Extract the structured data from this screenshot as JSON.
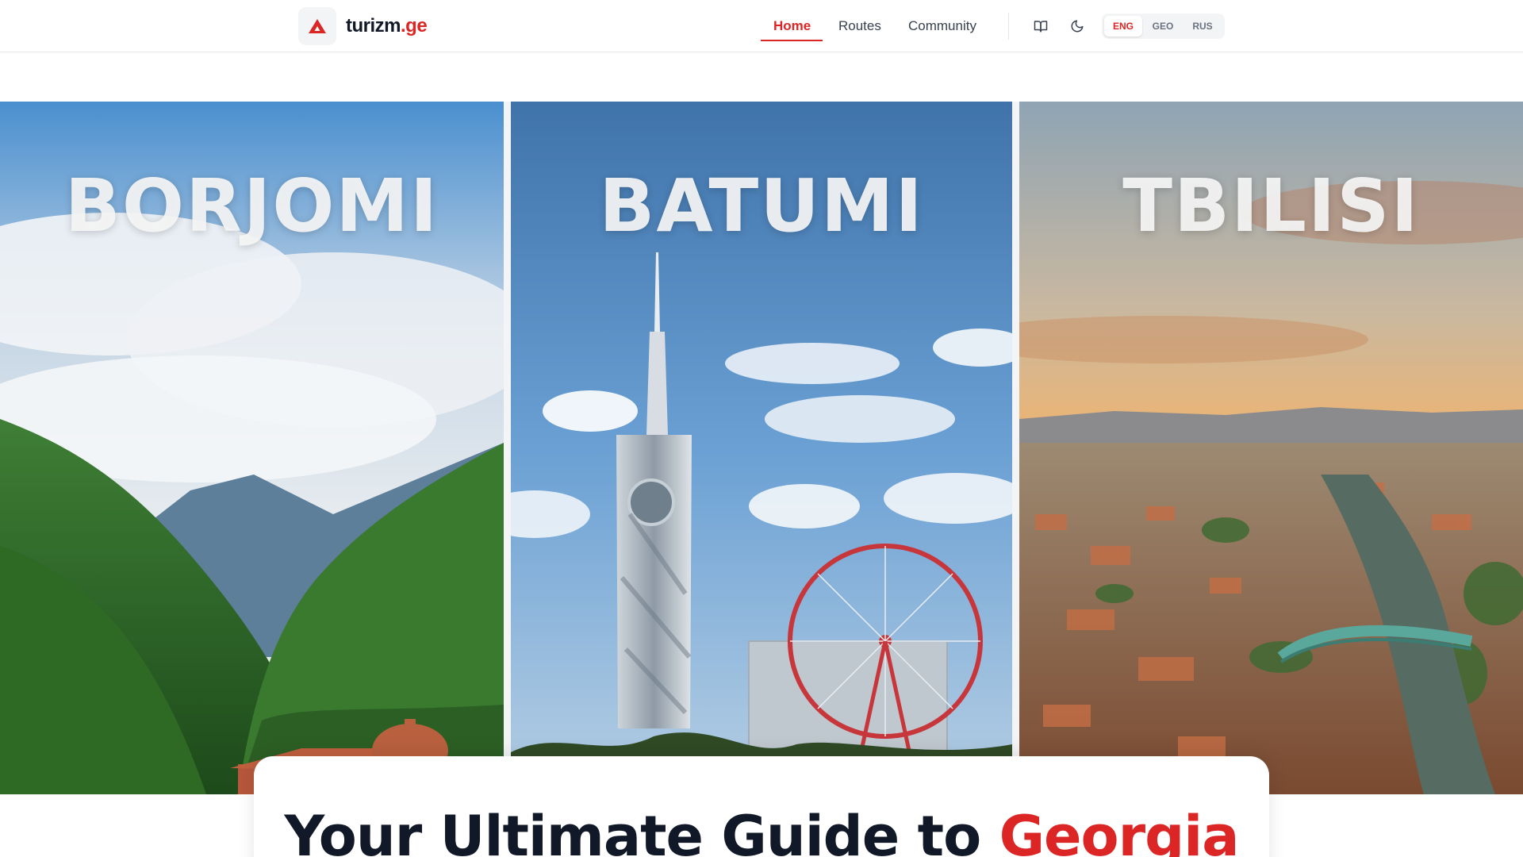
{
  "brand": {
    "name": "turizm",
    "tld": ".ge",
    "icon": "mountain-logo-icon",
    "accent_color": "#dc2626"
  },
  "nav": {
    "links": [
      {
        "label": "Home",
        "active": true
      },
      {
        "label": "Routes",
        "active": false
      },
      {
        "label": "Community",
        "active": false
      }
    ],
    "icons": {
      "guide": "book-icon",
      "theme": "moon-icon"
    },
    "languages": [
      {
        "code": "ENG",
        "active": true
      },
      {
        "code": "GEO",
        "active": false
      },
      {
        "code": "RUS",
        "active": false
      }
    ]
  },
  "hero": {
    "panels": [
      {
        "title": "BORJOMI"
      },
      {
        "title": "BATUMI"
      },
      {
        "title": "TBILISI"
      }
    ]
  },
  "headline": {
    "prefix": "Your Ultimate Guide to ",
    "highlight": "Georgia"
  }
}
